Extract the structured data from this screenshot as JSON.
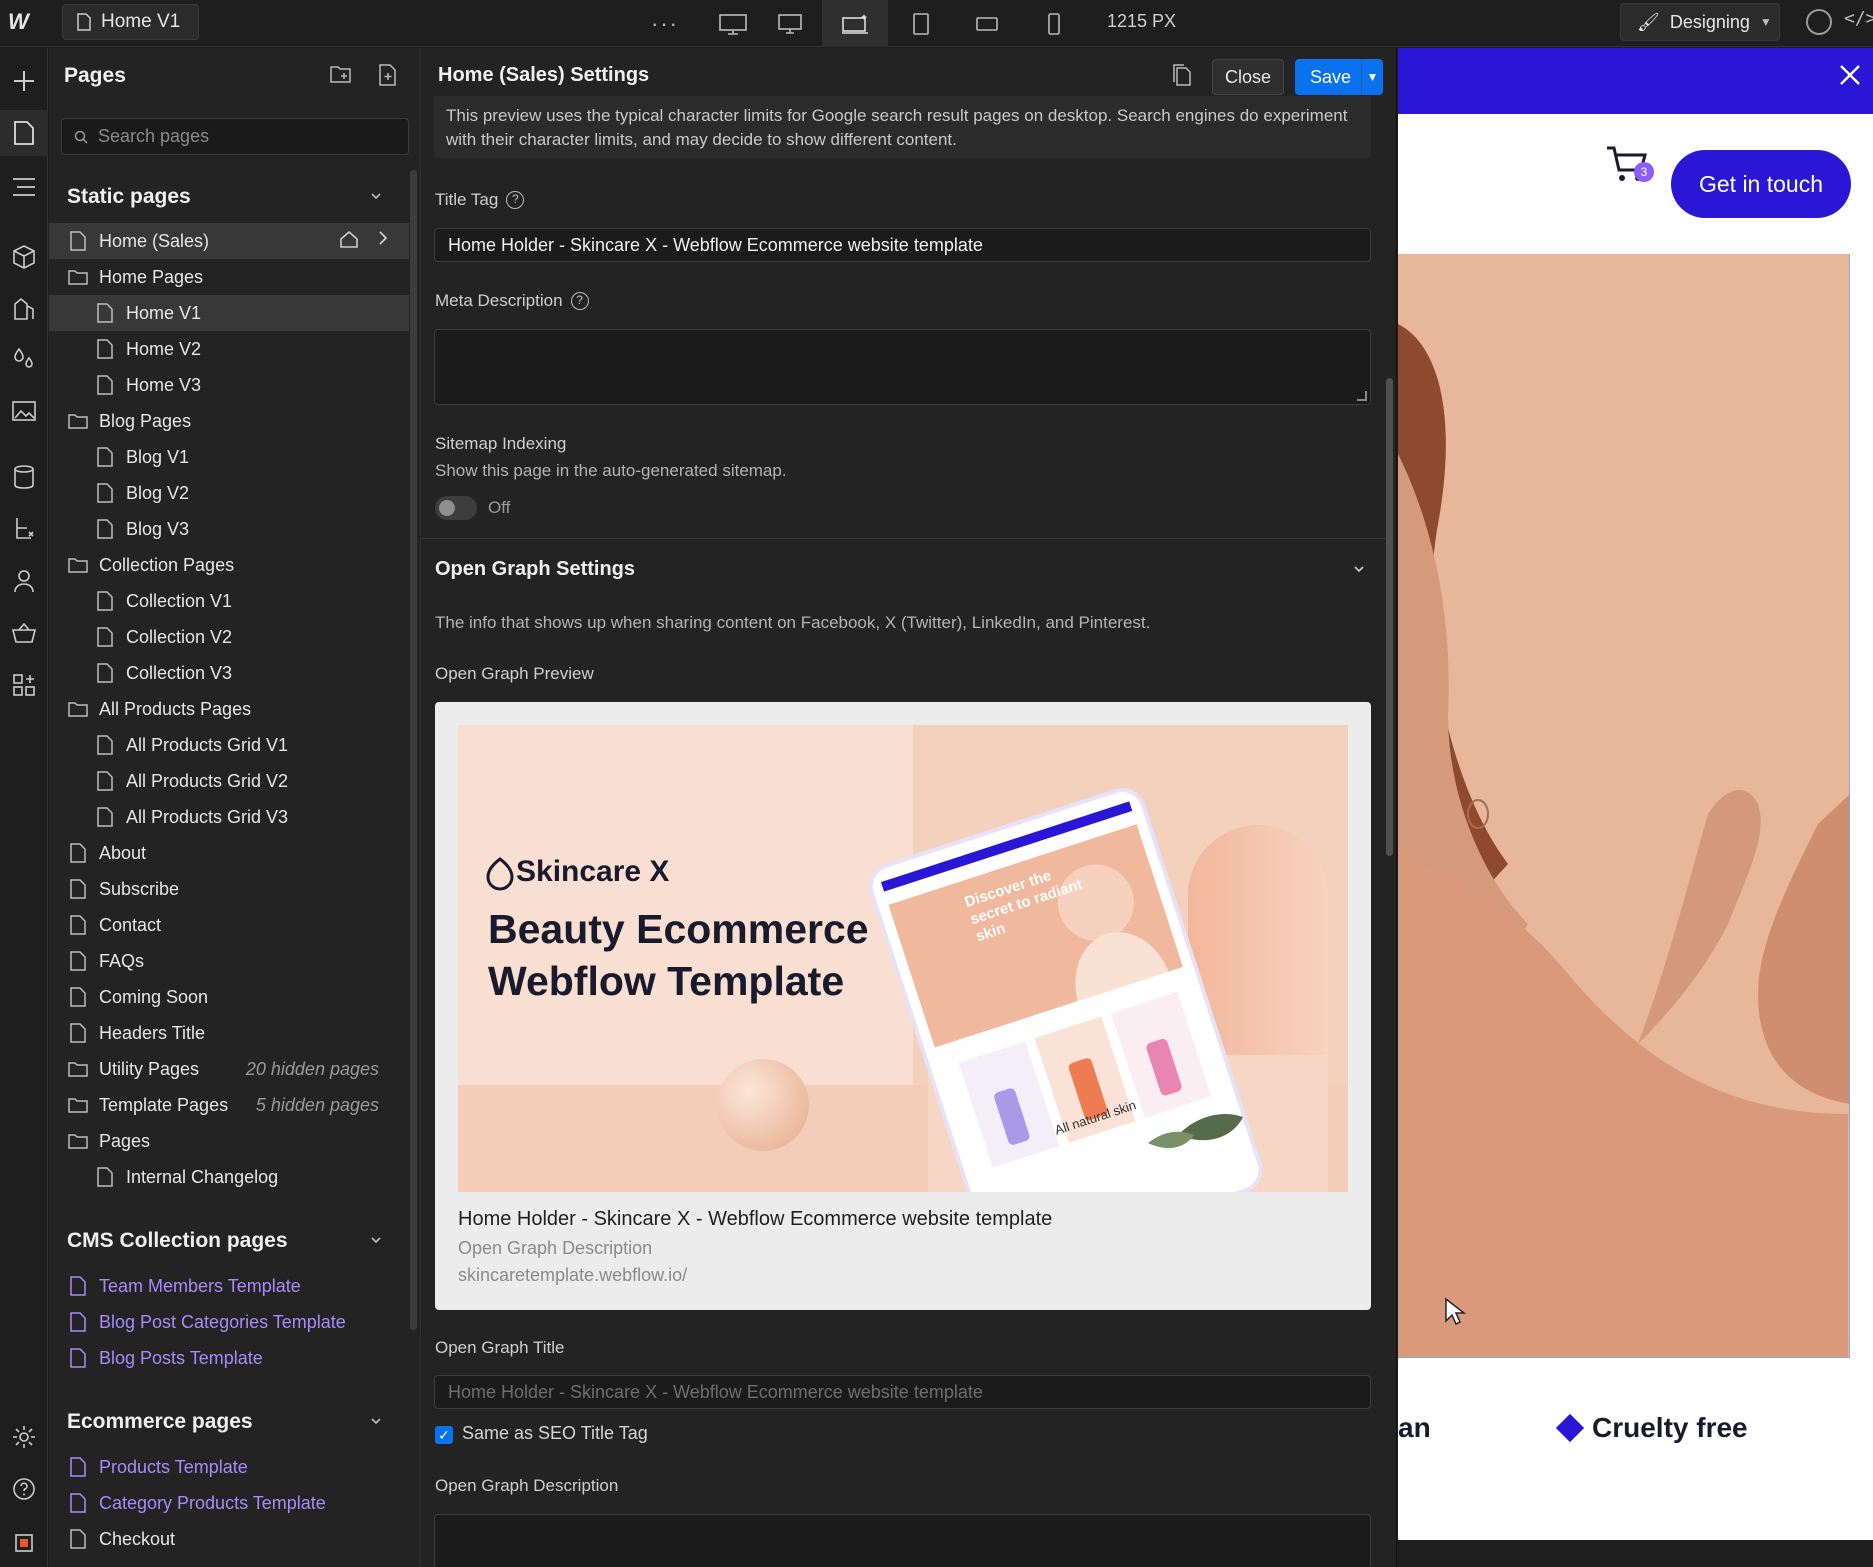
{
  "topbar": {
    "page_tab": "Home V1",
    "px_readout": "1215 PX",
    "mode": "Designing"
  },
  "pages_panel": {
    "title": "Pages",
    "search_placeholder": "Search pages",
    "static_header": "Static pages",
    "static_items": [
      {
        "label": "Home (Sales)",
        "type": "page",
        "level": 0,
        "note": ""
      },
      {
        "label": "Home Pages",
        "type": "folder",
        "level": 0,
        "note": ""
      },
      {
        "label": "Home V1",
        "type": "page",
        "level": 1,
        "note": ""
      },
      {
        "label": "Home V2",
        "type": "page",
        "level": 1,
        "note": ""
      },
      {
        "label": "Home V3",
        "type": "page",
        "level": 1,
        "note": ""
      },
      {
        "label": "Blog Pages",
        "type": "folder",
        "level": 0,
        "note": ""
      },
      {
        "label": "Blog V1",
        "type": "page",
        "level": 1,
        "note": ""
      },
      {
        "label": "Blog V2",
        "type": "page",
        "level": 1,
        "note": ""
      },
      {
        "label": "Blog V3",
        "type": "page",
        "level": 1,
        "note": ""
      },
      {
        "label": "Collection Pages",
        "type": "folder",
        "level": 0,
        "note": ""
      },
      {
        "label": "Collection V1",
        "type": "page",
        "level": 1,
        "note": ""
      },
      {
        "label": "Collection V2",
        "type": "page",
        "level": 1,
        "note": ""
      },
      {
        "label": "Collection V3",
        "type": "page",
        "level": 1,
        "note": ""
      },
      {
        "label": "All Products Pages",
        "type": "folder",
        "level": 0,
        "note": ""
      },
      {
        "label": "All Products Grid V1",
        "type": "page",
        "level": 1,
        "note": ""
      },
      {
        "label": "All Products Grid V2",
        "type": "page",
        "level": 1,
        "note": ""
      },
      {
        "label": "All Products Grid V3",
        "type": "page",
        "level": 1,
        "note": ""
      },
      {
        "label": "About",
        "type": "page",
        "level": 0,
        "note": ""
      },
      {
        "label": "Subscribe",
        "type": "page",
        "level": 0,
        "note": ""
      },
      {
        "label": "Contact",
        "type": "page",
        "level": 0,
        "note": ""
      },
      {
        "label": "FAQs",
        "type": "page",
        "level": 0,
        "note": ""
      },
      {
        "label": "Coming Soon",
        "type": "page",
        "level": 0,
        "note": ""
      },
      {
        "label": "Headers Title",
        "type": "page",
        "level": 0,
        "note": ""
      },
      {
        "label": "Utility Pages",
        "type": "folder",
        "level": 0,
        "note": "20 hidden pages"
      },
      {
        "label": "Template Pages",
        "type": "folder",
        "level": 0,
        "note": "5 hidden pages"
      },
      {
        "label": "Pages",
        "type": "folder",
        "level": 0,
        "note": ""
      },
      {
        "label": "Internal Changelog",
        "type": "page",
        "level": 1,
        "note": ""
      }
    ],
    "cms_header": "CMS Collection pages",
    "cms_items": [
      "Team Members Template",
      "Blog Post Categories Template",
      "Blog Posts Template"
    ],
    "ecom_header": "Ecommerce pages",
    "ecom_items": [
      {
        "label": "Products Template",
        "cms": true
      },
      {
        "label": "Category Products Template",
        "cms": true
      },
      {
        "label": "Checkout",
        "cms": false
      }
    ]
  },
  "settings": {
    "title": "Home (Sales) Settings",
    "close_label": "Close",
    "save_label": "Save",
    "info_text": "This preview uses the typical character limits for Google search result pages on desktop. Search engines do experiment with their character limits, and may decide to show different content.",
    "title_tag_label": "Title Tag",
    "title_tag_value": "Home Holder - Skincare X - Webflow Ecommerce website template",
    "meta_desc_label": "Meta Description",
    "meta_desc_value": "",
    "sitemap_label": "Sitemap Indexing",
    "sitemap_sub": "Show this page in the auto-generated sitemap.",
    "sitemap_state": "Off",
    "og_header": "Open Graph Settings",
    "og_info": "The info that shows up when sharing content on Facebook, X (Twitter), LinkedIn, and Pinterest.",
    "og_preview_label": "Open Graph Preview",
    "og_preview": {
      "brand": "Skincare X",
      "headline_1": "Beauty Ecommerce",
      "headline_2": "Webflow Template",
      "tablet_text": "Discover the secret to radiant skin",
      "tablet_footer": "All natural skin",
      "title": "Home Holder - Skincare X - Webflow Ecommerce website template",
      "description": "Open Graph Description",
      "url": "skincaretemplate.webflow.io/"
    },
    "og_title_label": "Open Graph Title",
    "og_title_placeholder": "Home Holder - Skincare X - Webflow Ecommerce website template",
    "og_same_label": "Same as SEO Title Tag",
    "og_desc_label": "Open Graph Description"
  },
  "canvas": {
    "cta": "Get in touch",
    "cart_count": "3",
    "strip_left": "an",
    "strip_right": "Cruelty free"
  },
  "colors": {
    "accent": "#0a72ef",
    "brand": "#2a17d6",
    "cms": "#a78bfa"
  }
}
